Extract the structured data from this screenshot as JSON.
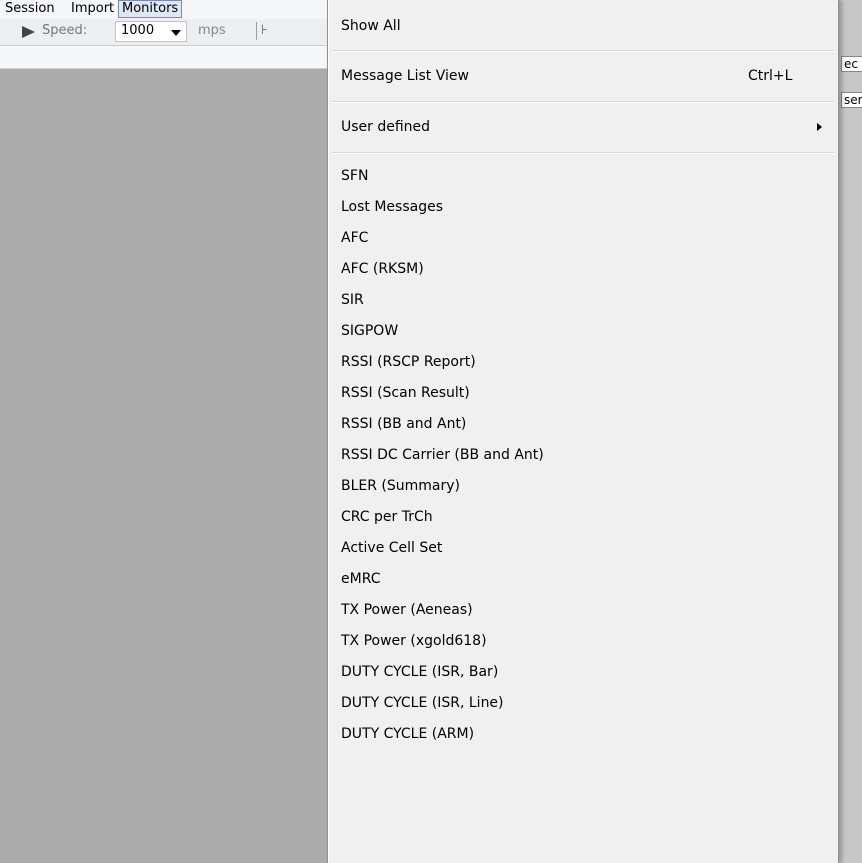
{
  "menubar": {
    "items": [
      {
        "label": "Session"
      },
      {
        "label": "Import"
      },
      {
        "label": "Monitors"
      }
    ]
  },
  "toolbar": {
    "speed_label": "Speed:",
    "speed_value": "1000",
    "unit_label": "mps"
  },
  "right_fragments": {
    "top": "ec",
    "bottom": "ser"
  },
  "dropdown": {
    "show_all": "Show All",
    "message_list_view": {
      "label": "Message List View",
      "shortcut": "Ctrl+L"
    },
    "user_defined": "User defined",
    "monitors": [
      "SFN",
      "Lost Messages",
      "AFC",
      "AFC (RKSM)",
      "SIR",
      "SIGPOW",
      "RSSI (RSCP Report)",
      "RSSI (Scan Result)",
      "RSSI (BB and Ant)",
      "RSSI DC Carrier (BB and Ant)",
      "BLER (Summary)",
      "CRC per TrCh",
      "Active Cell Set",
      "eMRC",
      "TX Power (Aeneas)",
      "TX Power (xgold618)",
      "DUTY CYCLE (ISR, Bar)",
      "DUTY CYCLE (ISR, Line)",
      "DUTY CYCLE (ARM)"
    ]
  }
}
